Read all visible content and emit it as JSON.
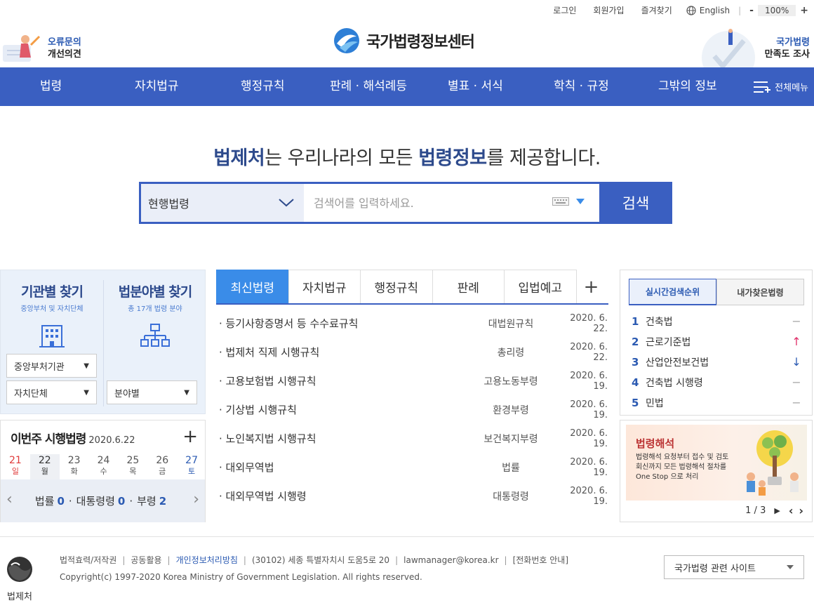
{
  "topbar": {
    "login": "로그인",
    "signup": "회원가입",
    "favorites": "즐겨찾기",
    "english": "English",
    "zoom_minus": "-",
    "zoom_value": "100%",
    "zoom_plus": "+"
  },
  "header": {
    "error_line1": "오류문의",
    "error_line2": "개선의견",
    "logo_title": "국가법령정보센터",
    "survey_line1": "국가법령",
    "survey_line2": "만족도 조사"
  },
  "nav": {
    "items": [
      "법령",
      "자치법규",
      "행정규칙",
      "판례 · 해석례등",
      "별표 · 서식",
      "학칙 · 규정",
      "그밖의 정보"
    ],
    "all_menu": "전체메뉴"
  },
  "hero": {
    "part1": "법제처",
    "part2": "는 우리나라의 모든 ",
    "part3": "법령정보",
    "part4": "를 제공합니다."
  },
  "search": {
    "scope": "현행법령",
    "placeholder": "검색어를 입력하세요.",
    "button": "검색"
  },
  "find": {
    "agency_title": "기관별 찾기",
    "agency_sub": "중앙부처 및 자치단체",
    "field_title": "법분야별 찾기",
    "field_sub": "총 17개 법령 분야",
    "select_central": "중앙부처기관",
    "select_local": "자치단체",
    "select_field": "분야별"
  },
  "week": {
    "title": "이번주 시행법령",
    "date": "2020.6.22",
    "plus": "+",
    "days": [
      {
        "n": "21",
        "w": "일",
        "color": "#e03a3a"
      },
      {
        "n": "22",
        "w": "월",
        "color": "#333333"
      },
      {
        "n": "23",
        "w": "화",
        "color": "#555555"
      },
      {
        "n": "24",
        "w": "수",
        "color": "#555555"
      },
      {
        "n": "25",
        "w": "목",
        "color": "#555555"
      },
      {
        "n": "26",
        "w": "금",
        "color": "#555555"
      },
      {
        "n": "27",
        "w": "토",
        "color": "#2b5ab2"
      }
    ],
    "law_label": "법률",
    "law_count": "0",
    "decree_label": "대통령령",
    "decree_count": "0",
    "ministry_label": "부령",
    "ministry_count": "2",
    "dot": "·",
    "prev": "‹",
    "next": "›"
  },
  "tabs": {
    "items": [
      "최신법령",
      "자치법규",
      "행정규칙",
      "판례",
      "입법예고"
    ],
    "plus": "+"
  },
  "laws": [
    {
      "title": "· 등기사항증명서 등 수수료규칙",
      "cat": "대법원규칙",
      "date": "2020. 6. 22."
    },
    {
      "title": "· 법제처 직제 시행규칙",
      "cat": "총리령",
      "date": "2020. 6. 22."
    },
    {
      "title": "· 고용보험법 시행규칙",
      "cat": "고용노동부령",
      "date": "2020. 6. 19."
    },
    {
      "title": "· 기상법 시행규칙",
      "cat": "환경부령",
      "date": "2020. 6. 19."
    },
    {
      "title": "· 노인복지법 시행규칙",
      "cat": "보건복지부령",
      "date": "2020. 6. 19."
    },
    {
      "title": "· 대외무역법",
      "cat": "법률",
      "date": "2020. 6. 19."
    },
    {
      "title": "· 대외무역법 시행령",
      "cat": "대통령령",
      "date": "2020. 6. 19."
    }
  ],
  "rank": {
    "tab_realtime": "실시간검색순위",
    "tab_mine": "내가찾은법령",
    "items": [
      {
        "n": "1",
        "t": "건축법",
        "m": "−",
        "color": "#aaaaaa"
      },
      {
        "n": "2",
        "t": "근로기준법",
        "m": "↑",
        "color": "#e0306a"
      },
      {
        "n": "3",
        "t": "산업안전보건법",
        "m": "↓",
        "color": "#2b5ab2"
      },
      {
        "n": "4",
        "t": "건축법 시행령",
        "m": "−",
        "color": "#aaaaaa"
      },
      {
        "n": "5",
        "t": "민법",
        "m": "−",
        "color": "#aaaaaa"
      }
    ]
  },
  "banner": {
    "title": "법령해석",
    "desc1": "법령해석 요청부터 접수 및 검토",
    "desc2": "회신까지 모든 법령해석 절차를",
    "desc3": "One Stop 으로 처리",
    "page": "1 / 3"
  },
  "footer": {
    "org": "법제처",
    "links": [
      "법적효력/저작권",
      "공동활용",
      "개인정보처리방침",
      "(30102) 세종 특별자치시 도움5로 20",
      "lawmanager@korea.kr",
      "[전화번호 안내]"
    ],
    "copyright": "Copyright(c) 1997-2020 Korea Ministry of Government Legislation. All rights reserved.",
    "related_sites": "국가법령 관련 사이트"
  },
  "colors": {
    "nav": "#3a5fc1",
    "tab_active": "#3a8ce8",
    "accent_text": "#2d4a8c"
  }
}
